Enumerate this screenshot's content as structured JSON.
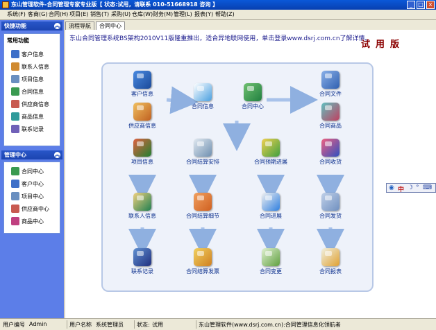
{
  "window": {
    "title": "东山管理软件-合同管理专家专业版【 状态:试用，请联系 010-51668918 咨询 】",
    "min": "_",
    "max": "□",
    "close": "×"
  },
  "menu": [
    "系统(F)",
    "客商(G)",
    "合同(H)",
    "项目(E)",
    "销售(T)",
    "采购(U)",
    "仓库(W)",
    "财务(M)",
    "管理(L)",
    "报表(Y)",
    "帮助(Z)"
  ],
  "sidebar": {
    "quick_header": "快捷功能",
    "common": {
      "title": "常用功能",
      "items": [
        "客户信息",
        "联系人信息",
        "项目信息",
        "合同信息",
        "供应商信息",
        "商品信息",
        "联系记录"
      ]
    },
    "manage_header": "管理中心",
    "manage_items": [
      "合同中心",
      "客户中心",
      "项目中心",
      "供应商中心",
      "商品中心"
    ]
  },
  "tabs": [
    "流程导航",
    "合同中心"
  ],
  "banner": "东山合同管理系统BS架构2010V11版隆重推出，适合异地联网使用，单击登录www.dsrj.com.cn了解详情。",
  "trial_mark": "试用版",
  "flow": {
    "customer": "客户信息",
    "contract_info": "合同信息",
    "contract_center": "合同中心",
    "contract_file": "合同文件",
    "supplier": "供应商信息",
    "goods": "合同商品",
    "project": "项目信息",
    "settle_plan": "合同结算安排",
    "forecast": "合同预期进展",
    "receipt": "合同收货",
    "contact": "联系人信息",
    "settle_detail": "合同结算细节",
    "progress": "合同进展",
    "delivery": "合同发货",
    "record": "联系记录",
    "invoice": "合同结算发票",
    "change": "合同变更",
    "report": "合同报表"
  },
  "status": {
    "user_no_label": "用户编号",
    "user_no": "Admin",
    "user_name_label": "用户名称",
    "user_name": "系统管理员",
    "state_label": "状态:",
    "state": "试用",
    "company": "东山管理软件(www.dsrj.com.cn):合同管理信息化领航者"
  },
  "ime": {
    "mode": "中"
  },
  "colors": {
    "title_blue": "#0a58d8",
    "sidebar_blue": "#5c7ee8",
    "trial_red": "#8b0000",
    "label_blue": "#0a2e8c"
  }
}
